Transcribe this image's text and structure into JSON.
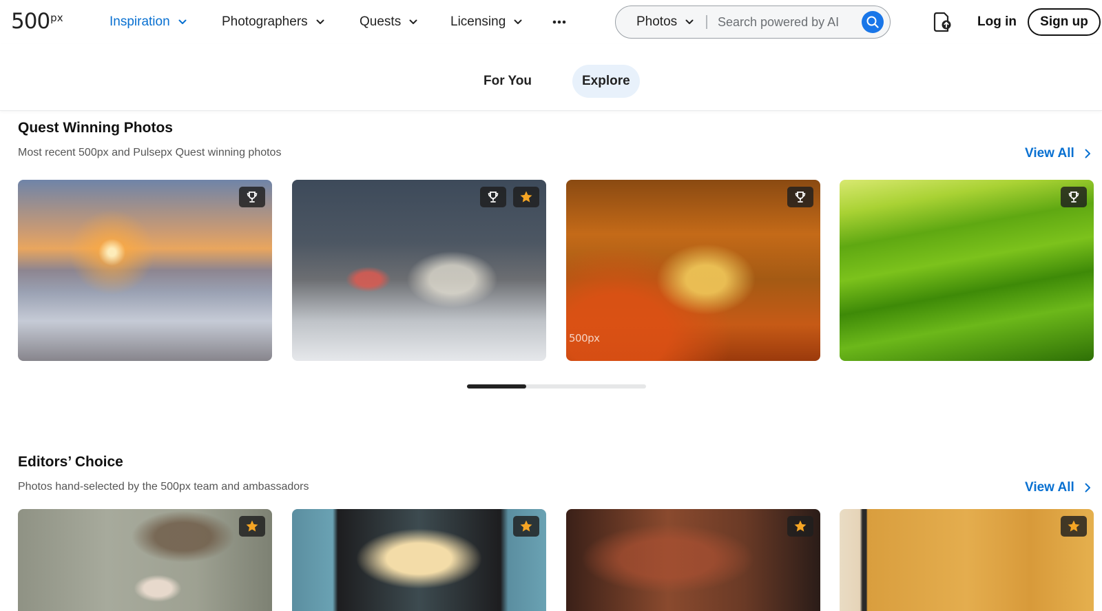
{
  "header": {
    "logo_main": "500",
    "logo_sup": "px",
    "nav": [
      {
        "label": "Inspiration",
        "active": true
      },
      {
        "label": "Photographers",
        "active": false
      },
      {
        "label": "Quests",
        "active": false
      },
      {
        "label": "Licensing",
        "active": false
      }
    ],
    "more_icon": "more-horizontal-icon",
    "search": {
      "type_label": "Photos",
      "placeholder": "Search powered by AI",
      "icon": "search-icon"
    },
    "upload_icon": "upload-icon",
    "login_label": "Log in",
    "signup_label": "Sign up"
  },
  "subtabs": [
    {
      "label": "For You",
      "active": false
    },
    {
      "label": "Explore",
      "active": true
    }
  ],
  "sections": [
    {
      "title": "Quest Winning Photos",
      "subtitle": "Most recent 500px and Pulsepx Quest winning photos",
      "view_all": "View All",
      "cards": [
        {
          "badges": [
            "trophy-icon"
          ],
          "watermark": ""
        },
        {
          "badges": [
            "trophy-icon",
            "star-icon"
          ],
          "watermark": ""
        },
        {
          "badges": [
            "trophy-icon"
          ],
          "watermark": "500px"
        },
        {
          "badges": [
            "trophy-icon"
          ],
          "watermark": ""
        }
      ],
      "progress": 0.33
    },
    {
      "title": "Editors’ Choice",
      "subtitle": "Photos hand-selected by the 500px team and ambassadors",
      "view_all": "View All",
      "cards": [
        {
          "badges": [
            "star-icon"
          ]
        },
        {
          "badges": [
            "star-icon"
          ]
        },
        {
          "badges": [
            "star-icon"
          ]
        },
        {
          "badges": [
            "star-icon"
          ]
        }
      ]
    }
  ],
  "colors": {
    "accent": "#0870d1",
    "search_button": "#1976e8",
    "active_tab_bg": "#e8f1fb",
    "badge_star": "#f5a524"
  }
}
